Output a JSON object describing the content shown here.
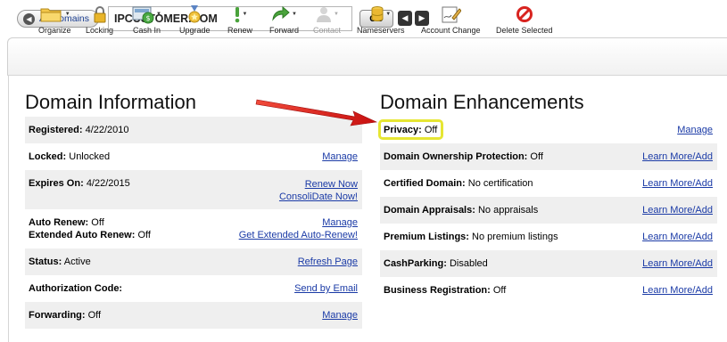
{
  "topbar": {
    "back_label": "All Domains",
    "domain_value": "IPCUSTOMER.COM",
    "go_label": "GO"
  },
  "toolbar": {
    "items": [
      {
        "label": "Organize",
        "icon": "folder-icon"
      },
      {
        "label": "Locking",
        "icon": "lock-icon"
      },
      {
        "label": "Cash In",
        "icon": "cash-in-icon"
      },
      {
        "label": "Upgrade",
        "icon": "upgrade-icon"
      },
      {
        "label": "Renew",
        "icon": "renew-icon"
      },
      {
        "label": "Forward",
        "icon": "forward-arrow-icon"
      },
      {
        "label": "Contact",
        "icon": "contact-icon",
        "disabled": true
      },
      {
        "label": "Nameservers",
        "icon": "nameservers-icon"
      },
      {
        "label": "Account Change",
        "icon": "account-change-icon"
      },
      {
        "label": "Delete Selected",
        "icon": "delete-icon"
      }
    ]
  },
  "domain_info": {
    "title": "Domain Information",
    "registered": {
      "label": "Registered:",
      "value": "4/22/2010"
    },
    "locked": {
      "label": "Locked:",
      "value": "Unlocked",
      "link": "Manage"
    },
    "expires": {
      "label": "Expires On:",
      "value": "4/22/2015",
      "link1": "Renew Now",
      "link2": "ConsoliDate Now!"
    },
    "auto_renew": {
      "label": "Auto Renew:",
      "value": "Off",
      "link": "Manage"
    },
    "extended_auto_renew": {
      "label": "Extended Auto Renew:",
      "value": "Off",
      "link": "Get Extended Auto-Renew!"
    },
    "status": {
      "label": "Status:",
      "value": "Active",
      "link": "Refresh Page"
    },
    "auth_code": {
      "label": "Authorization Code:",
      "link": "Send by Email"
    },
    "forwarding": {
      "label": "Forwarding:",
      "value": "Off",
      "link": "Manage"
    }
  },
  "enhancements": {
    "title": "Domain Enhancements",
    "privacy": {
      "label": "Privacy:",
      "value": "Off",
      "link": "Manage"
    },
    "ownership": {
      "label": "Domain Ownership Protection:",
      "value": "Off",
      "link": "Learn More/Add"
    },
    "certified": {
      "label": "Certified Domain:",
      "value": "No certification",
      "link": "Learn More/Add"
    },
    "appraisals": {
      "label": "Domain Appraisals:",
      "value": "No appraisals",
      "link": "Learn More/Add"
    },
    "premium": {
      "label": "Premium Listings:",
      "value": "No premium listings",
      "link": "Learn More/Add"
    },
    "cashparking": {
      "label": "CashParking:",
      "value": "Disabled",
      "link": "Learn More/Add"
    },
    "business": {
      "label": "Business Registration:",
      "value": "Off",
      "link": "Learn More/Add"
    }
  },
  "colors": {
    "link": "#1a3aa6",
    "highlight": "#e6e633",
    "arrow": "#e01b1b",
    "row_shade": "#efefef"
  }
}
